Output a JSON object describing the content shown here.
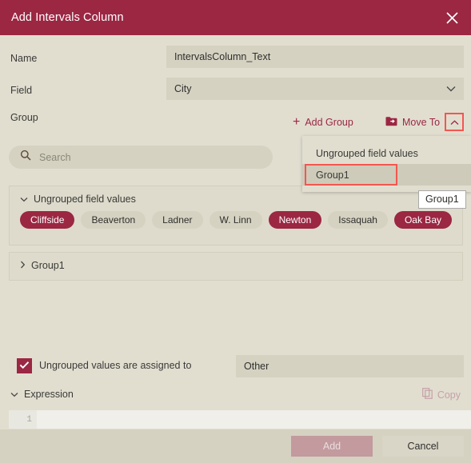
{
  "window": {
    "title": "Add Intervals Column",
    "close_icon": "close-icon"
  },
  "form": {
    "name_label": "Name",
    "name_value": "IntervalsColumn_Text",
    "field_label": "Field",
    "field_value": "City",
    "field_caret_icon": "chevron-down-icon"
  },
  "group": {
    "label": "Group",
    "add_group_label": "Add Group",
    "add_group_icon": "plus-icon",
    "move_to_label": "Move To",
    "move_to_icon": "move-to-folder-icon",
    "move_to_caret_icon": "chevron-up-icon"
  },
  "search": {
    "icon": "search-icon",
    "placeholder": "Search",
    "value": ""
  },
  "move_to_menu": {
    "items": [
      {
        "label": "Ungrouped field values",
        "hovered": false
      },
      {
        "label": "Group1",
        "hovered": true
      }
    ]
  },
  "tooltip": {
    "text": "Group1"
  },
  "ungrouped_panel": {
    "expand_icon": "chevron-down-icon",
    "title": "Ungrouped field values",
    "chips": [
      {
        "label": "Cliffside",
        "selected": true
      },
      {
        "label": "Beaverton",
        "selected": false
      },
      {
        "label": "Ladner",
        "selected": false
      },
      {
        "label": "W. Linn",
        "selected": false
      },
      {
        "label": "Newton",
        "selected": true
      },
      {
        "label": "Issaquah",
        "selected": false
      },
      {
        "label": "Oak Bay",
        "selected": true
      }
    ]
  },
  "group1_panel": {
    "expand_icon": "chevron-right-icon",
    "title": "Group1"
  },
  "assign": {
    "checked": true,
    "check_icon": "checkmark-icon",
    "label": "Ungrouped values are assigned to",
    "value": "Other"
  },
  "expression": {
    "expand_icon": "chevron-down-icon",
    "label": "Expression",
    "copy_label": "Copy",
    "copy_icon": "copy-icon",
    "line_number": "1",
    "code": ""
  },
  "footer": {
    "add_label": "Add",
    "cancel_label": "Cancel"
  },
  "colors": {
    "accent": "#9b2743",
    "background": "#e1ded0",
    "field": "#d5d2c2",
    "highlight_border": "#f4564f",
    "add_disabled": "#c39a9e"
  }
}
